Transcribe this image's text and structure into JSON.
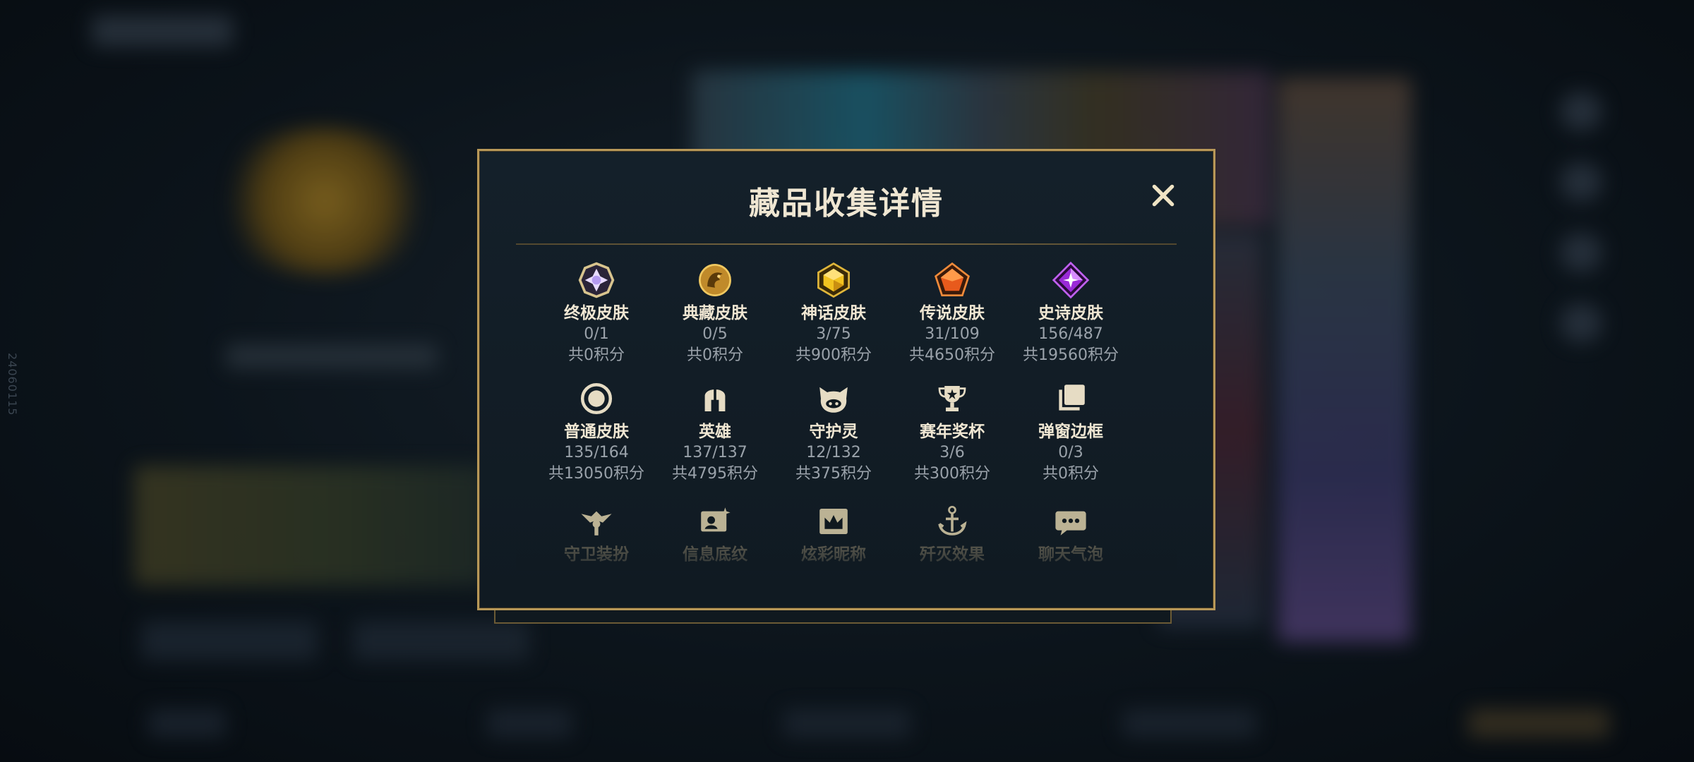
{
  "modal": {
    "title": "藏品收集详情",
    "close_glyph": "✕"
  },
  "watermark": "24060115",
  "collection": [
    {
      "label": "终极皮肤",
      "count": "0/1",
      "points": "共0积分",
      "icon": "ultimate-skin-icon"
    },
    {
      "label": "典藏皮肤",
      "count": "0/5",
      "points": "共0积分",
      "icon": "prestige-skin-icon"
    },
    {
      "label": "神话皮肤",
      "count": "3/75",
      "points": "共900积分",
      "icon": "mythic-skin-icon"
    },
    {
      "label": "传说皮肤",
      "count": "31/109",
      "points": "共4650积分",
      "icon": "legendary-skin-icon"
    },
    {
      "label": "史诗皮肤",
      "count": "156/487",
      "points": "共19560积分",
      "icon": "epic-skin-icon"
    },
    {
      "label": "普通皮肤",
      "count": "135/164",
      "points": "共13050积分",
      "icon": "normal-skin-icon"
    },
    {
      "label": "英雄",
      "count": "137/137",
      "points": "共4795积分",
      "icon": "champion-helmet-icon"
    },
    {
      "label": "守护灵",
      "count": "12/132",
      "points": "共375积分",
      "icon": "ward-spirit-icon"
    },
    {
      "label": "赛年奖杯",
      "count": "3/6",
      "points": "共300积分",
      "icon": "trophy-icon"
    },
    {
      "label": "弹窗边框",
      "count": "0/3",
      "points": "共0积分",
      "icon": "frame-icon"
    },
    {
      "label": "守卫装扮",
      "icon": "ward-skin-icon"
    },
    {
      "label": "信息底纹",
      "icon": "info-card-icon"
    },
    {
      "label": "炫彩昵称",
      "icon": "crown-nickname-icon"
    },
    {
      "label": "歼灭效果",
      "icon": "anchor-effect-icon"
    },
    {
      "label": "聊天气泡",
      "icon": "chat-bubble-icon"
    }
  ],
  "colors": {
    "gold": "#b89858",
    "title": "#efe6d2",
    "muted": "#9aa2aa"
  }
}
